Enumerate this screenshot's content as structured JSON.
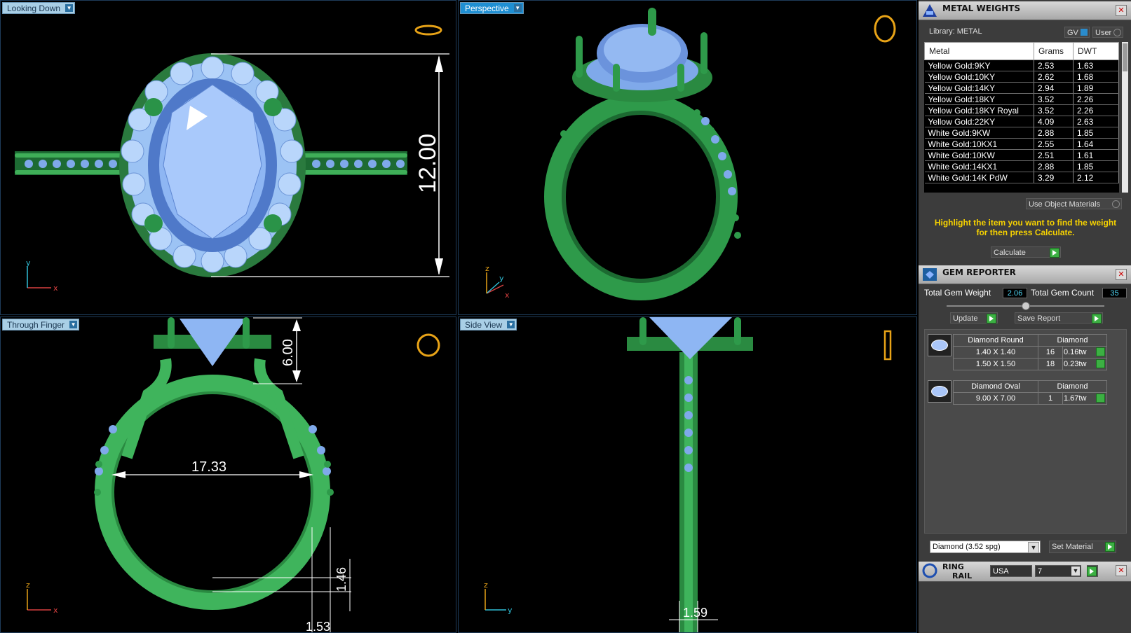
{
  "viewports": {
    "top_left": {
      "label": "Looking Down",
      "dim_height": "12.00"
    },
    "top_right": {
      "label": "Perspective"
    },
    "bottom_left": {
      "label": "Through Finger",
      "dim_height": "6.00",
      "dim_diameter": "17.33",
      "dim_band": "1.46",
      "dim_width": "1.53"
    },
    "bottom_right": {
      "label": "Side View",
      "dim_width": "1.59"
    },
    "axis": {
      "x": "x",
      "y": "y",
      "z": "z"
    }
  },
  "metal_weights": {
    "title": "METAL WEIGHTS",
    "library_label": "Library: METAL",
    "gv_label": "GV",
    "user_label": "User",
    "columns": [
      "Metal",
      "Grams",
      "DWT"
    ],
    "rows": [
      {
        "metal": "Yellow Gold:9KY",
        "grams": "2.53",
        "dwt": "1.63"
      },
      {
        "metal": "Yellow Gold:10KY",
        "grams": "2.62",
        "dwt": "1.68"
      },
      {
        "metal": "Yellow Gold:14KY",
        "grams": "2.94",
        "dwt": "1.89"
      },
      {
        "metal": "Yellow Gold:18KY",
        "grams": "3.52",
        "dwt": "2.26"
      },
      {
        "metal": "Yellow Gold:18KY Royal",
        "grams": "3.52",
        "dwt": "2.26"
      },
      {
        "metal": "Yellow Gold:22KY",
        "grams": "4.09",
        "dwt": "2.63"
      },
      {
        "metal": "White Gold:9KW",
        "grams": "2.88",
        "dwt": "1.85"
      },
      {
        "metal": "White Gold:10KX1",
        "grams": "2.55",
        "dwt": "1.64"
      },
      {
        "metal": "White Gold:10KW",
        "grams": "2.51",
        "dwt": "1.61"
      },
      {
        "metal": "White Gold:14KX1",
        "grams": "2.88",
        "dwt": "1.85"
      },
      {
        "metal": "White Gold:14K PdW",
        "grams": "3.29",
        "dwt": "2.12"
      }
    ],
    "use_object_materials": "Use Object Materials",
    "hint": "Highlight the item you want to find the weight for then press Calculate.",
    "calculate": "Calculate"
  },
  "gem_reporter": {
    "title": "GEM REPORTER",
    "total_weight_label": "Total Gem Weight",
    "total_weight": "2.06",
    "total_count_label": "Total Gem Count",
    "total_count": "35",
    "update": "Update",
    "save_report": "Save Report",
    "groups": [
      {
        "name": "Diamond Round",
        "material": "Diamond",
        "rows": [
          {
            "size": "1.40 X 1.40",
            "count": "16",
            "tw": "0.16tw"
          },
          {
            "size": "1.50 X 1.50",
            "count": "18",
            "tw": "0.23tw"
          }
        ]
      },
      {
        "name": "Diamond Oval",
        "material": "Diamond",
        "rows": [
          {
            "size": "9.00 X 7.00",
            "count": "1",
            "tw": "1.67tw"
          }
        ]
      }
    ],
    "material_select": "Diamond     (3.52 spg)",
    "set_material": "Set Material"
  },
  "ring_rail": {
    "title_line1": "RING",
    "title_line2": "RAIL",
    "region": "USA",
    "size": "7"
  },
  "colors": {
    "metal": "#2f9e47",
    "gem": "#7aa7ee",
    "accent": "#1f8fd3"
  }
}
